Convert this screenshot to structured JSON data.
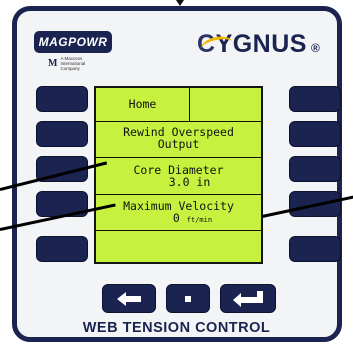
{
  "brand": {
    "magpowr": "MAGPOWR",
    "maxcess_mark": "M",
    "maxcess_text": "A Maxcess\nInternational\nCompany",
    "cygnus": "YGNUS",
    "cygnus_initial": "C",
    "reg": "®",
    "accent": "#f2b705",
    "navy": "#1b2450"
  },
  "screen": {
    "background": "#c6f23f",
    "home_label": "Home",
    "rows": [
      {
        "line1": "Rewind Overspeed",
        "line2": "Output"
      },
      {
        "line1": "Core Diameter",
        "line2": "3.0 in"
      },
      {
        "line1": "Maximum Velocity",
        "value": "0",
        "unit": "ft/min"
      }
    ]
  },
  "nav": {
    "left_icon": "left-arrow-icon",
    "center_icon": "dot-icon",
    "enter_icon": "enter-icon"
  },
  "footer": "WEB TENSION CONTROL"
}
